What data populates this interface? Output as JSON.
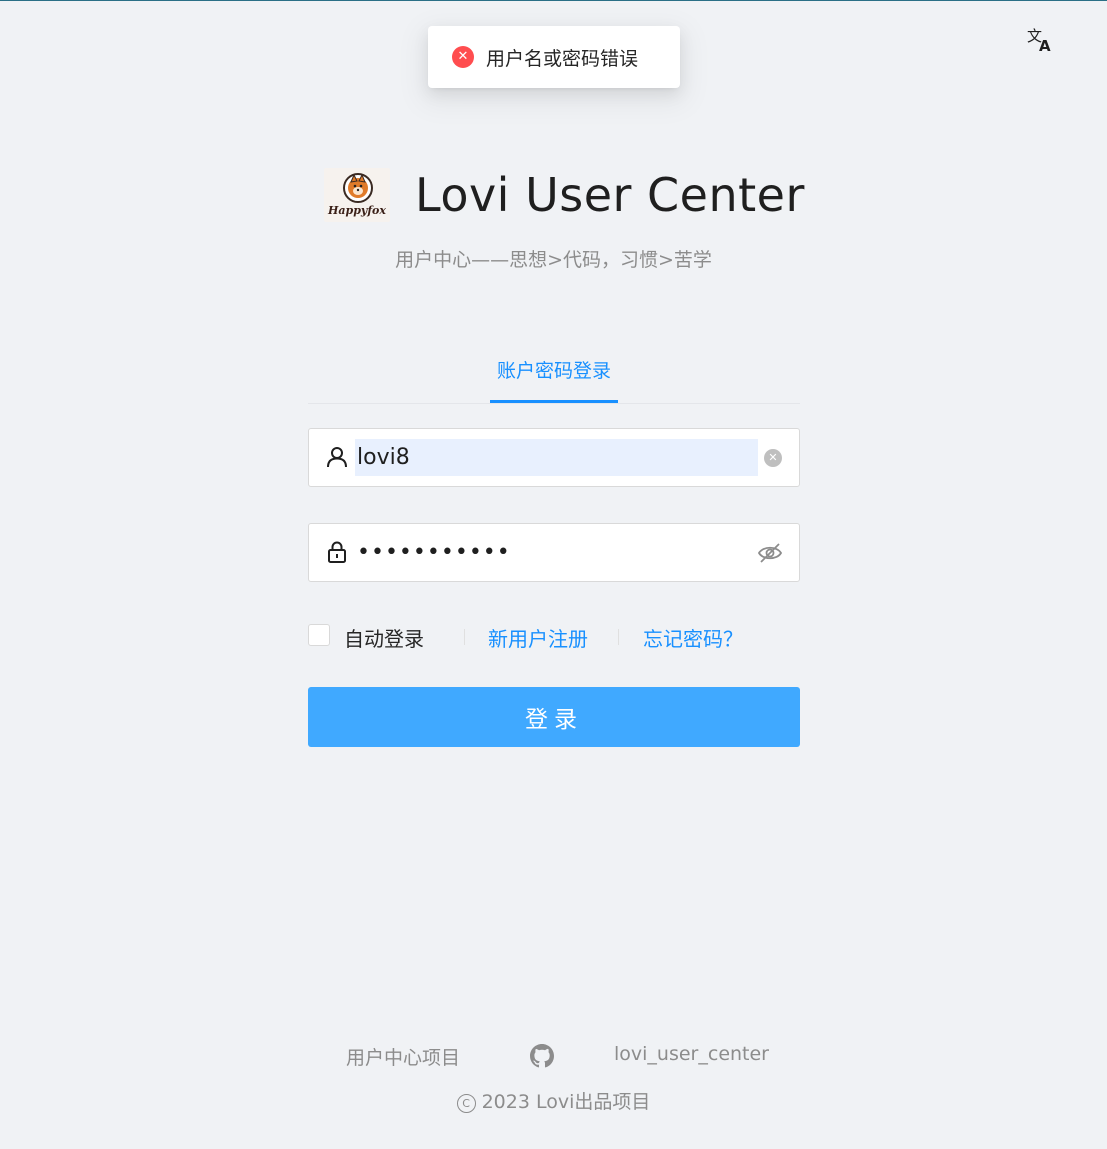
{
  "toast": {
    "icon": "error-icon",
    "glyph": "✕",
    "message": "用户名或密码错误"
  },
  "language_switch": {
    "icon": "translate-icon"
  },
  "header": {
    "logo_icon": "happyfox-logo",
    "logo_text": "Happyfox",
    "title": "Lovi User Center",
    "subtitle": "用户中心——思想>代码，习惯>苦学"
  },
  "tabs": [
    {
      "label": "账户密码登录",
      "active": true
    }
  ],
  "form": {
    "username": {
      "value": "lovi8",
      "prefix_icon": "user-icon",
      "clear_icon": "clear-icon",
      "clear_glyph": "✕"
    },
    "password": {
      "value": "•••••••••••",
      "prefix_icon": "lock-icon",
      "toggle_icon": "eye-invisible-icon"
    },
    "auto_login": {
      "label": "自动登录",
      "checked": false
    },
    "register_link": "新用户注册",
    "forgot_link": "忘记密码？",
    "submit_label": "登录"
  },
  "footer": {
    "links": [
      {
        "label": "用户中心项目"
      },
      {
        "icon": "github-icon"
      },
      {
        "label": "lovi_user_center"
      }
    ],
    "copyright_symbol": "C",
    "copyright": "2023 Lovi出品项目"
  },
  "colors": {
    "primary": "#1890ff",
    "button": "#40a9ff",
    "error": "#ff4d4f",
    "background": "#f0f2f5"
  }
}
